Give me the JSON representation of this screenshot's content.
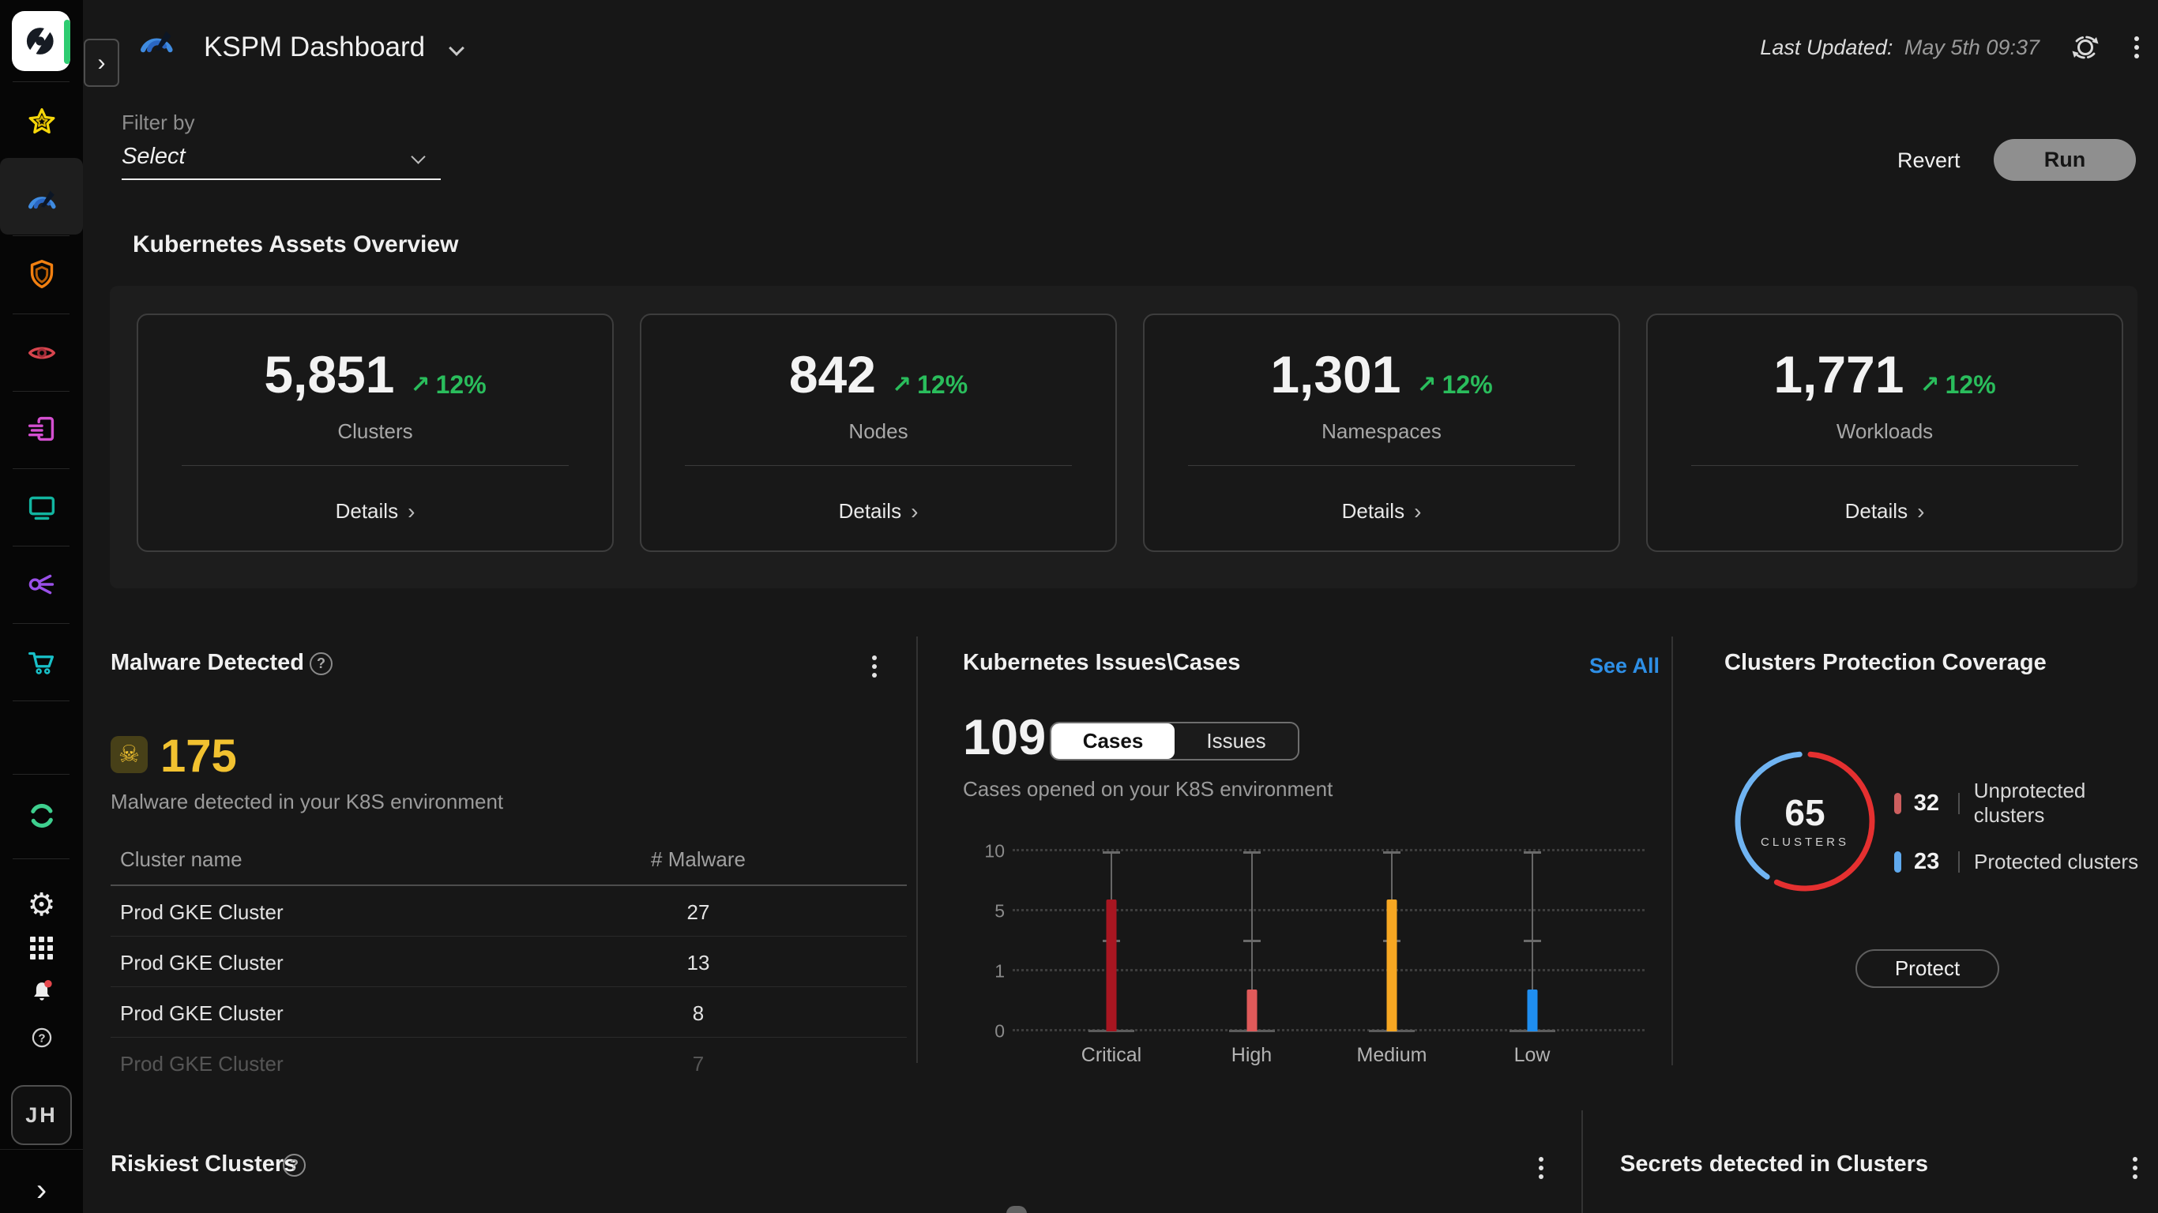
{
  "app": {
    "header": {
      "title": "KSPM Dashboard",
      "last_updated_label": "Last Updated:",
      "last_updated_value": "May 5th 09:37"
    },
    "filter": {
      "label": "Filter by",
      "value": "Select"
    },
    "actions": {
      "revert": "Revert",
      "run": "Run"
    }
  },
  "sidebar": {
    "nav_icons": [
      "star-icon",
      "gauge-icon",
      "shield-icon",
      "eye-icon",
      "document-send-icon",
      "monitor-icon",
      "share-icon",
      "cart-icon"
    ],
    "active_icon": "gauge-icon",
    "secondary_icons": [
      "loop-icon"
    ],
    "utility_icons": [
      "gear-icon",
      "grid-icon",
      "bell-icon",
      "help-icon"
    ],
    "bell_has_badge": true,
    "avatar_initials": "JH"
  },
  "assets_overview": {
    "title": "Kubernetes Assets Overview",
    "details_label": "Details",
    "delta_color": "#2abd5c",
    "cards": [
      {
        "value": "5,851",
        "delta": "12%",
        "delta_direction": "up",
        "label": "Clusters"
      },
      {
        "value": "842",
        "delta": "12%",
        "delta_direction": "up",
        "label": "Nodes"
      },
      {
        "value": "1,301",
        "delta": "12%",
        "delta_direction": "up",
        "label": "Namespaces"
      },
      {
        "value": "1,771",
        "delta": "12%",
        "delta_direction": "up",
        "label": "Workloads"
      }
    ]
  },
  "malware": {
    "title": "Malware Detected",
    "icon": "skull-icon",
    "count": "175",
    "count_color": "#f2c230",
    "subtitle": "Malware detected in your K8S environment",
    "table": {
      "columns": [
        "Cluster name",
        "# Malware"
      ],
      "rows": [
        {
          "cluster": "Prod GKE Cluster",
          "malware": "27",
          "faded": false
        },
        {
          "cluster": "Prod GKE Cluster",
          "malware": "13",
          "faded": false
        },
        {
          "cluster": "Prod GKE Cluster",
          "malware": "8",
          "faded": false
        },
        {
          "cluster": "Prod GKE Cluster",
          "malware": "7",
          "faded": true
        }
      ]
    }
  },
  "issues": {
    "title": "Kubernetes Issues\\Cases",
    "see_all": "See All",
    "count": "109",
    "toggle": {
      "options": [
        "Cases",
        "Issues"
      ],
      "selected": "Cases"
    },
    "subtitle": "Cases opened on your K8S environment"
  },
  "coverage": {
    "title": "Clusters Protection Coverage",
    "center_value": "65",
    "center_label": "CLUSTERS",
    "legend": [
      {
        "value": "32",
        "label": "Unprotected clusters",
        "color": "#cd5f5f"
      },
      {
        "value": "23",
        "label": "Protected clusters",
        "color": "#5fa9ee"
      }
    ],
    "button": "Protect"
  },
  "bottom_panels": {
    "riskiest": {
      "title": "Riskiest Clusters"
    },
    "secrets": {
      "title": "Secrets detected in Clusters"
    }
  },
  "chart_data": [
    {
      "id": "cases_by_severity",
      "type": "bar",
      "title": "Cases opened on your K8S environment",
      "categories": [
        "Critical",
        "High",
        "Medium",
        "Low"
      ],
      "values": [
        6,
        0.7,
        6,
        0.7
      ],
      "bar_colors": [
        "#a81621",
        "#e05a5a",
        "#f7a722",
        "#1f8ef0"
      ],
      "whiskers": {
        "min": 0,
        "mid": 3,
        "max": 10
      },
      "y_ticks": [
        0,
        1,
        5,
        10
      ],
      "y_scale": "non-linear, ticks evenly spaced",
      "grid": "horizontal dotted",
      "legend_position": "none",
      "xlabel": "",
      "ylabel": ""
    },
    {
      "id": "clusters_protection_coverage",
      "type": "donut",
      "total": 65,
      "total_label": "CLUSTERS",
      "segments": [
        {
          "label": "Unprotected clusters",
          "value": 32,
          "color": "#e53030"
        },
        {
          "label": "Protected clusters",
          "value": 23,
          "color": "#70b4f2"
        }
      ]
    }
  ]
}
